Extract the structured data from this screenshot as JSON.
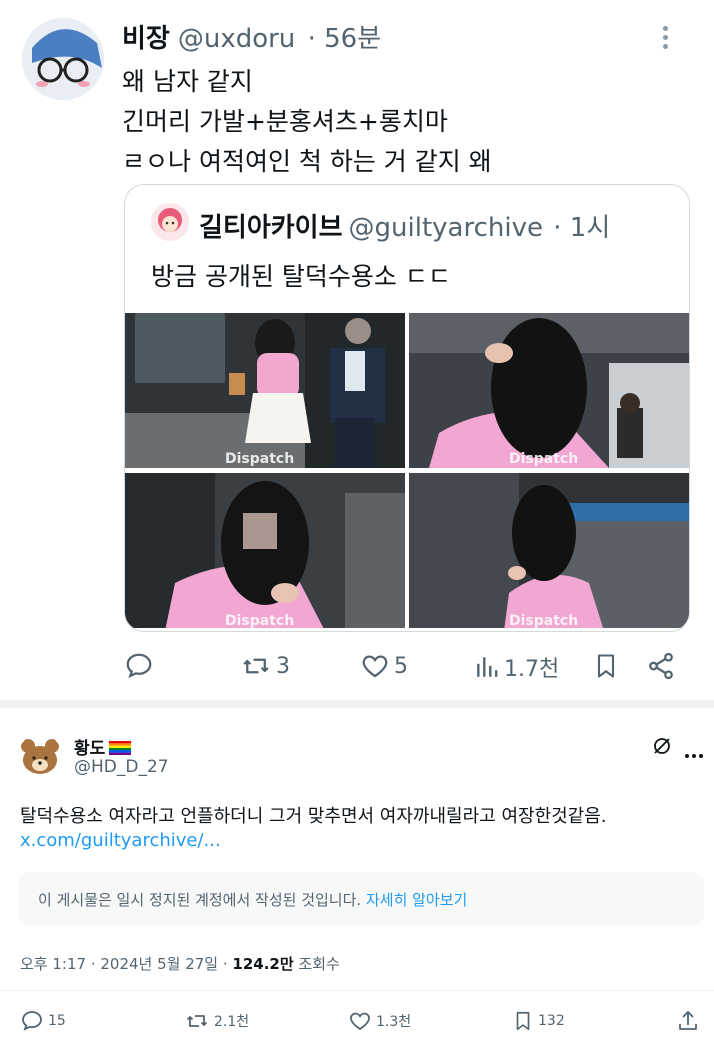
{
  "tweet": {
    "name": "비장",
    "handle": "@uxdoru",
    "time": "· 56분",
    "lines": [
      "왜 남자 같지",
      "긴머리 가발+분홍셔츠+롱치마",
      "ㄹㅇ나 여적여인 척 하는 거 같지 왜"
    ],
    "quote": {
      "name": "길티아카이브",
      "handle": "@guiltyarchive",
      "time": "· 1시",
      "text": "방금 공개된 탈덕수용소 ㄷㄷ",
      "watermark": "Dispatch"
    },
    "actions": {
      "reply_icon": "reply-icon",
      "retweets": "3",
      "likes": "5",
      "views": "1.7천",
      "bookmark_icon": "bookmark-icon",
      "share_icon": "share-icon"
    }
  },
  "reply": {
    "name": "황도",
    "handle": "@HD_D_27",
    "text": "탈덕수용소 여자라고 언플하더니 그거 맞추면서 여자까내릴라고 여장한것같음.",
    "link": "x.com/guiltyarchive/...",
    "notice": "이 게시물은 일시 정지된 계정에서 작성된 것입니다.",
    "notice_link": "자세히 알아보기",
    "meta_time": "오후 1:17 · 2024년 5월 27일 · ",
    "views_count": "124.2만",
    "views_label": " 조회수",
    "actions": {
      "replies": "15",
      "retweets": "2.1천",
      "likes": "1.3천",
      "bookmarks": "132"
    }
  },
  "colors": {
    "accent": "#1d9bf0",
    "muted": "#536471",
    "text": "#0f1419"
  }
}
